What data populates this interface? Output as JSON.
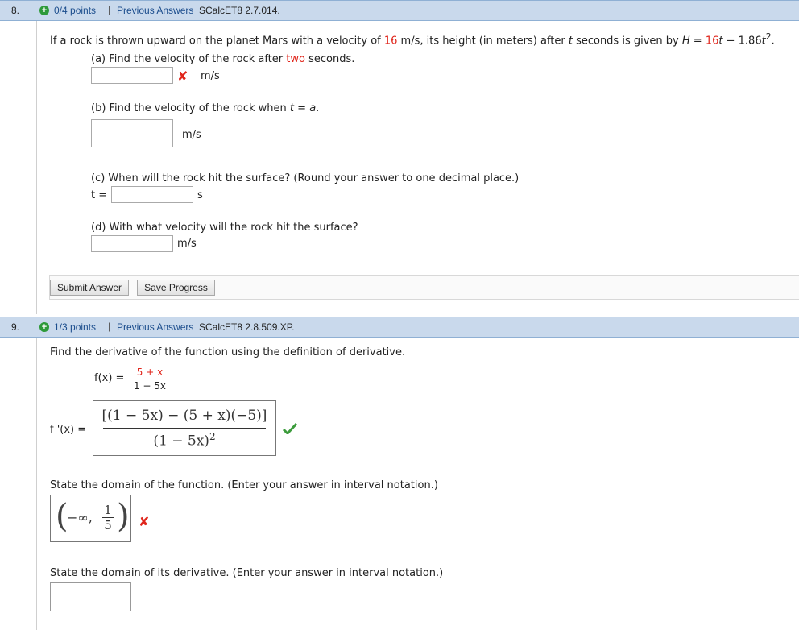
{
  "q8": {
    "number": "8.",
    "points": "0/4 points",
    "separator": "|",
    "previous_answers": "Previous Answers",
    "code": "SCalcET8 2.7.014.",
    "prompt_text_1": "If a rock is thrown upward on the planet Mars with a velocity of ",
    "velocity": "16",
    "prompt_text_2": " m/s, its height (in meters) after ",
    "t": "t",
    "prompt_text_3": " seconds is given by ",
    "H": "H",
    "eq_sign": " = ",
    "coef": "16",
    "t2": "t",
    "minus": " − 1.86",
    "t3": "t",
    "exp": "2",
    "period": ".",
    "a_text_1": "(a) Find the velocity of the rock after ",
    "a_two": "two",
    "a_text_2": " seconds.",
    "a_unit": "m/s",
    "b_text_1": "(b) Find the velocity of the rock when ",
    "b_t": "t",
    "b_eq": " = ",
    "b_a": "a",
    "b_period": ".",
    "b_unit": "m/s",
    "c_text": "(c) When will the rock hit the surface? (Round your answer to one decimal place.)",
    "c_t_label": "t =",
    "c_unit": "s",
    "d_text": "(d) With what velocity will the rock hit the surface?",
    "d_unit": "m/s",
    "submit_label": "Submit Answer",
    "save_label": "Save Progress"
  },
  "q9": {
    "number": "9.",
    "points": "1/3 points",
    "separator": "|",
    "previous_answers": "Previous Answers",
    "code": "SCalcET8 2.8.509.XP.",
    "prompt": "Find the derivative of the function using the definition of derivative.",
    "fx_label": "f(x) =",
    "fx_num": "5 + x",
    "fx_den": "1 − 5x",
    "fpx_label": "f '(x) =",
    "ans_num": "[(1 − 5x) − (5 + x)(−5)]",
    "ans_den_base": "(1 − 5x)",
    "ans_den_exp": "2",
    "domain_prompt": "State the domain of the function. (Enter your answer in interval notation.)",
    "domain_left": "−∞,",
    "domain_num": "1",
    "domain_den": "5",
    "deriv_domain_prompt": "State the domain of its derivative. (Enter your answer in interval notation.)"
  },
  "colors": {
    "bar": "#c9d9ec",
    "link": "#1a4c8c",
    "error": "#e0261c",
    "correct": "#3c9c3c"
  }
}
